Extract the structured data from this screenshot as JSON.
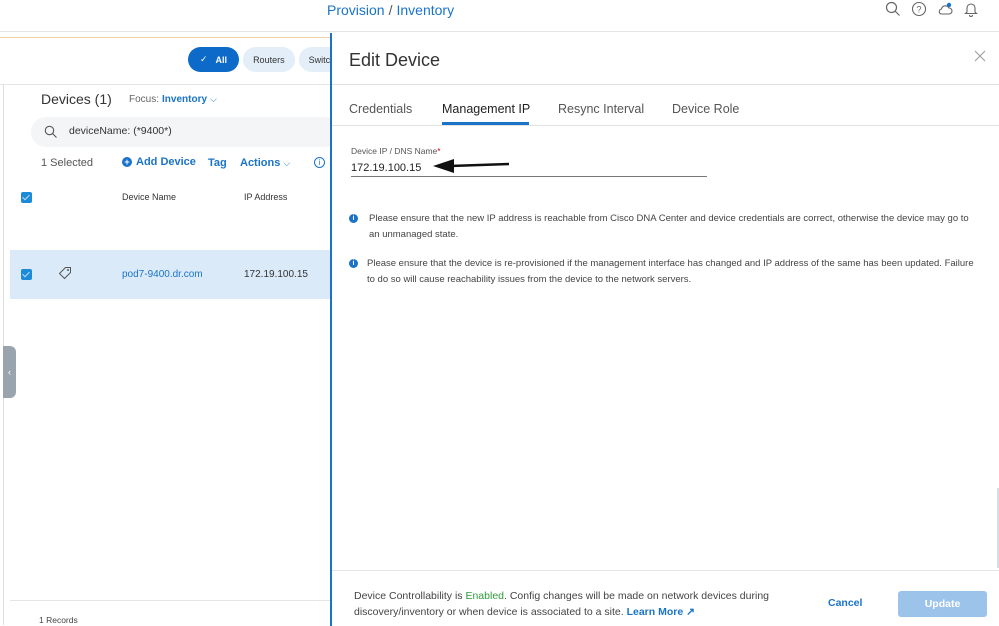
{
  "header": {
    "breadcrumb": [
      "Provision",
      "Inventory"
    ],
    "breadcrumb_separator": "/",
    "icons": [
      "search-icon",
      "help-icon",
      "cloud-icon",
      "bell-icon"
    ]
  },
  "left_panel": {
    "filter_chips": [
      {
        "label": "All",
        "active": true
      },
      {
        "label": "Routers",
        "active": false
      },
      {
        "label": "Switch",
        "active": false
      }
    ],
    "title": "Devices (1)",
    "focus_label": "Focus:",
    "focus_value": "Inventory",
    "search_value": "deviceName: (*9400*)",
    "selected_count": "1 Selected",
    "add_device": "Add Device",
    "tag": "Tag",
    "actions": "Actions",
    "table": {
      "columns": [
        "Device Name",
        "IP Address"
      ],
      "rows": [
        {
          "device_name": "pod7-9400.dr.com",
          "ip_address": "172.19.100.15",
          "selected": true
        }
      ]
    },
    "records": "1 Records"
  },
  "drawer": {
    "title": "Edit Device",
    "tabs": [
      {
        "label": "Credentials",
        "active": false
      },
      {
        "label": "Management IP",
        "active": true
      },
      {
        "label": "Resync Interval",
        "active": false
      },
      {
        "label": "Device Role",
        "active": false
      }
    ],
    "field": {
      "label": "Device IP / DNS Name",
      "required_mark": "*",
      "value": "172.19.100.15"
    },
    "notes": [
      "Please ensure that the new IP address is reachable from Cisco DNA Center and device credentials are correct, otherwise the device may go to an unmanaged state.",
      "Please ensure that the device is re-provisioned if the management interface has changed and IP address of the same has been updated. Failure to do so will cause reachability issues from the device to the network servers."
    ],
    "footer": {
      "prefix": "Device Controllability is ",
      "status": "Enabled",
      "suffix": ". Config changes will be made on network devices during discovery/inventory or when device is associated to a site. ",
      "learn_more": "Learn More",
      "cancel": "Cancel",
      "update": "Update"
    },
    "colors": {
      "accent": "#1a73c9",
      "enabled": "#2e9b3a",
      "update_disabled": "#9cc3ea"
    }
  }
}
